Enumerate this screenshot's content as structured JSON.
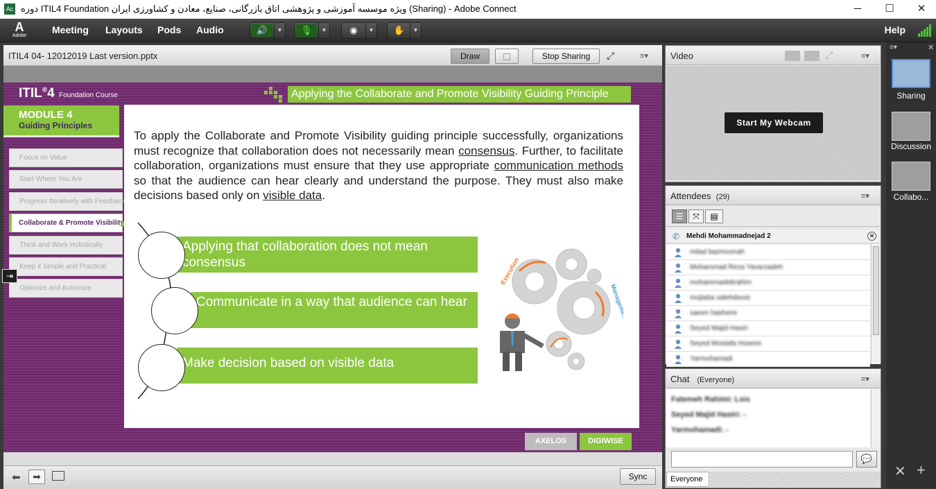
{
  "window": {
    "app_icon": "adobe-connect-app-icon",
    "title": "دوره ITIL4 Foundation ویژه موسسه آموزشی و پژوهشی اتاق بازرگانی، صنایع، معادن و کشاورزی ایران (Sharing) - Adobe Connect",
    "minimize": "─",
    "maximize": "☐",
    "close": "✕"
  },
  "menubar": {
    "logo_text": "Adobe",
    "items": [
      "Meeting",
      "Layouts",
      "Pods",
      "Audio"
    ],
    "help": "Help"
  },
  "share_pod": {
    "title": "ITIL4 04- 12012019 Last version.pptx",
    "draw_label": "Draw",
    "stop_sharing_label": "Stop Sharing",
    "sync_label": "Sync"
  },
  "slide": {
    "brand": "ITIL",
    "brand_sup": "®",
    "brand_num": "4",
    "brand_sub": "Foundation Course",
    "title": "Applying the Collaborate and Promote Visibility Guiding Principle",
    "module_line1": "MODULE 4",
    "module_line2": "Guiding Principles",
    "nav": [
      "Focus on Value",
      "Start Where You Are",
      "Progress Iteratively with Feedback",
      "Collaborate & Promote Visibility",
      "Think and Work Holistically",
      "Keep it Simple and Practical",
      "Optimize and Automate"
    ],
    "active_nav_index": 3,
    "para_1": "To apply the Collaborate and Promote Visibility guiding principle successfully, organizations must recognize that collaboration does not necessarily mean ",
    "para_u1": "consensus",
    "para_2": ". Further, to facilitate collaboration, organizations must ensure that they use appropriate ",
    "para_u2": "communication methods",
    "para_3": " so that the audience can hear clearly and understand the purpose. They must also make decisions based only on ",
    "para_u3": "visible data",
    "para_4": ".",
    "points": [
      "Applying that collaboration does not mean consensus",
      "Communicate in a way that audience can hear",
      "Make decision based on visible data"
    ],
    "gear_label_1": "Execution",
    "gear_label_2": "Management",
    "logo_axelos": "AXELOS",
    "logo_digiwise": "DIGIWISE"
  },
  "video_pod": {
    "title": "Video",
    "webcam_button": "Start My Webcam"
  },
  "attendees_pod": {
    "title": "Attendees",
    "count": "(29)",
    "host": "Mehdi Mohammadnejad 2",
    "attendees": [
      "milad bazmoonah",
      "Mohammad Reza Yavarzadeh",
      "mohammadebrahim",
      "mojtaba salehdoost",
      "saeen hashemi",
      "Seyed Majid Hasiri",
      "Seyed Mostafa Hoseini",
      "Yarmohamadi"
    ]
  },
  "chat_pod": {
    "title": "Chat",
    "scope": "(Everyone)",
    "messages": [
      "Fatemeh Rahimi: Lsis",
      "Seyed Majid Hasiri: -",
      "Yarmohamadi: -"
    ],
    "input_placeholder": "",
    "tab_label": "Everyone"
  },
  "layouts": {
    "items": [
      "Sharing",
      "Discussion",
      "Collabo..."
    ],
    "active_index": 0
  },
  "colors": {
    "slide_green": "#8cc63f",
    "slide_purple": "#6c2a6a",
    "active_mic": "#4fc23a"
  }
}
